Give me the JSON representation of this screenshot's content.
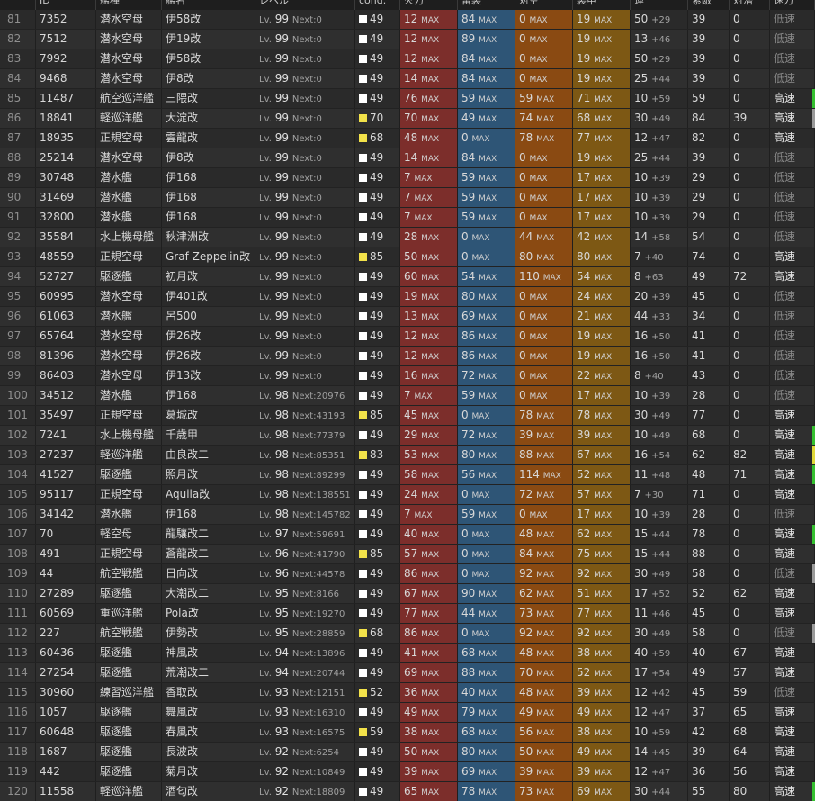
{
  "headers": [
    "ID",
    "艦種",
    "艦名",
    "レベル",
    "cond.",
    "火力",
    "雷装",
    "対空",
    "装甲",
    "運",
    "索敵",
    "対潜",
    "速力"
  ],
  "lv_label": "Lv.",
  "next_label": "Next:",
  "max_label": "MAX",
  "colors": {
    "cond_white": "#ffffff",
    "cond_yellow": "#f2e24a",
    "edge_green": "#35c030",
    "edge_yellow": "#e0d83a",
    "edge_gray": "#9a9a9a"
  },
  "rows": [
    {
      "n": "81",
      "id": "7352",
      "type": "潜水空母",
      "name": "伊58改",
      "lv": "99",
      "next": "0",
      "cond": "49",
      "cc": "w",
      "fp": "12",
      "tp": "84",
      "aa": "0",
      "ar": "19",
      "luck": "50",
      "lplus": "+29",
      "los": "39",
      "asw": "0",
      "speed": "低速",
      "edge": ""
    },
    {
      "n": "82",
      "id": "7512",
      "type": "潜水空母",
      "name": "伊19改",
      "lv": "99",
      "next": "0",
      "cond": "49",
      "cc": "w",
      "fp": "12",
      "tp": "89",
      "aa": "0",
      "ar": "19",
      "luck": "13",
      "lplus": "+46",
      "los": "39",
      "asw": "0",
      "speed": "低速",
      "edge": ""
    },
    {
      "n": "83",
      "id": "7992",
      "type": "潜水空母",
      "name": "伊58改",
      "lv": "99",
      "next": "0",
      "cond": "49",
      "cc": "w",
      "fp": "12",
      "tp": "84",
      "aa": "0",
      "ar": "19",
      "luck": "50",
      "lplus": "+29",
      "los": "39",
      "asw": "0",
      "speed": "低速",
      "edge": ""
    },
    {
      "n": "84",
      "id": "9468",
      "type": "潜水空母",
      "name": "伊8改",
      "lv": "99",
      "next": "0",
      "cond": "49",
      "cc": "w",
      "fp": "14",
      "tp": "84",
      "aa": "0",
      "ar": "19",
      "luck": "25",
      "lplus": "+44",
      "los": "39",
      "asw": "0",
      "speed": "低速",
      "edge": ""
    },
    {
      "n": "85",
      "id": "11487",
      "type": "航空巡洋艦",
      "name": "三隈改",
      "lv": "99",
      "next": "0",
      "cond": "49",
      "cc": "w",
      "fp": "76",
      "tp": "59",
      "aa": "59",
      "ar": "71",
      "luck": "10",
      "lplus": "+59",
      "los": "59",
      "asw": "0",
      "speed": "高速",
      "edge": "g"
    },
    {
      "n": "86",
      "id": "18841",
      "type": "軽巡洋艦",
      "name": "大淀改",
      "lv": "99",
      "next": "0",
      "cond": "70",
      "cc": "y",
      "fp": "70",
      "tp": "49",
      "aa": "74",
      "ar": "68",
      "luck": "30",
      "lplus": "+49",
      "los": "84",
      "asw": "39",
      "speed": "高速",
      "edge": "gr"
    },
    {
      "n": "87",
      "id": "18935",
      "type": "正規空母",
      "name": "雲龍改",
      "lv": "99",
      "next": "0",
      "cond": "68",
      "cc": "y",
      "fp": "48",
      "tp": "0",
      "aa": "78",
      "ar": "77",
      "luck": "12",
      "lplus": "+47",
      "los": "82",
      "asw": "0",
      "speed": "高速",
      "edge": ""
    },
    {
      "n": "88",
      "id": "25214",
      "type": "潜水空母",
      "name": "伊8改",
      "lv": "99",
      "next": "0",
      "cond": "49",
      "cc": "w",
      "fp": "14",
      "tp": "84",
      "aa": "0",
      "ar": "19",
      "luck": "25",
      "lplus": "+44",
      "los": "39",
      "asw": "0",
      "speed": "低速",
      "edge": ""
    },
    {
      "n": "89",
      "id": "30748",
      "type": "潜水艦",
      "name": "伊168",
      "lv": "99",
      "next": "0",
      "cond": "49",
      "cc": "w",
      "fp": "7",
      "tp": "59",
      "aa": "0",
      "ar": "17",
      "luck": "10",
      "lplus": "+39",
      "los": "29",
      "asw": "0",
      "speed": "低速",
      "edge": ""
    },
    {
      "n": "90",
      "id": "31469",
      "type": "潜水艦",
      "name": "伊168",
      "lv": "99",
      "next": "0",
      "cond": "49",
      "cc": "w",
      "fp": "7",
      "tp": "59",
      "aa": "0",
      "ar": "17",
      "luck": "10",
      "lplus": "+39",
      "los": "29",
      "asw": "0",
      "speed": "低速",
      "edge": ""
    },
    {
      "n": "91",
      "id": "32800",
      "type": "潜水艦",
      "name": "伊168",
      "lv": "99",
      "next": "0",
      "cond": "49",
      "cc": "w",
      "fp": "7",
      "tp": "59",
      "aa": "0",
      "ar": "17",
      "luck": "10",
      "lplus": "+39",
      "los": "29",
      "asw": "0",
      "speed": "低速",
      "edge": ""
    },
    {
      "n": "92",
      "id": "35584",
      "type": "水上機母艦",
      "name": "秋津洲改",
      "lv": "99",
      "next": "0",
      "cond": "49",
      "cc": "w",
      "fp": "28",
      "tp": "0",
      "aa": "44",
      "ar": "42",
      "luck": "14",
      "lplus": "+58",
      "los": "54",
      "asw": "0",
      "speed": "低速",
      "edge": ""
    },
    {
      "n": "93",
      "id": "48559",
      "type": "正規空母",
      "name": "Graf Zeppelin改",
      "lv": "99",
      "next": "0",
      "cond": "85",
      "cc": "y",
      "fp": "50",
      "tp": "0",
      "aa": "80",
      "ar": "80",
      "luck": "7",
      "lplus": "+40",
      "los": "74",
      "asw": "0",
      "speed": "高速",
      "edge": ""
    },
    {
      "n": "94",
      "id": "52727",
      "type": "駆逐艦",
      "name": "初月改",
      "lv": "99",
      "next": "0",
      "cond": "49",
      "cc": "w",
      "fp": "60",
      "tp": "54",
      "aa": "110",
      "ar": "54",
      "luck": "8",
      "lplus": "+63",
      "los": "49",
      "asw": "72",
      "speed": "高速",
      "edge": ""
    },
    {
      "n": "95",
      "id": "60995",
      "type": "潜水空母",
      "name": "伊401改",
      "lv": "99",
      "next": "0",
      "cond": "49",
      "cc": "w",
      "fp": "19",
      "tp": "80",
      "aa": "0",
      "ar": "24",
      "luck": "20",
      "lplus": "+39",
      "los": "45",
      "asw": "0",
      "speed": "低速",
      "edge": ""
    },
    {
      "n": "96",
      "id": "61063",
      "type": "潜水艦",
      "name": "呂500",
      "lv": "99",
      "next": "0",
      "cond": "49",
      "cc": "w",
      "fp": "13",
      "tp": "69",
      "aa": "0",
      "ar": "21",
      "luck": "44",
      "lplus": "+33",
      "los": "34",
      "asw": "0",
      "speed": "低速",
      "edge": ""
    },
    {
      "n": "97",
      "id": "65764",
      "type": "潜水空母",
      "name": "伊26改",
      "lv": "99",
      "next": "0",
      "cond": "49",
      "cc": "w",
      "fp": "12",
      "tp": "86",
      "aa": "0",
      "ar": "19",
      "luck": "16",
      "lplus": "+50",
      "los": "41",
      "asw": "0",
      "speed": "低速",
      "edge": ""
    },
    {
      "n": "98",
      "id": "81396",
      "type": "潜水空母",
      "name": "伊26改",
      "lv": "99",
      "next": "0",
      "cond": "49",
      "cc": "w",
      "fp": "12",
      "tp": "86",
      "aa": "0",
      "ar": "19",
      "luck": "16",
      "lplus": "+50",
      "los": "41",
      "asw": "0",
      "speed": "低速",
      "edge": ""
    },
    {
      "n": "99",
      "id": "86403",
      "type": "潜水空母",
      "name": "伊13改",
      "lv": "99",
      "next": "0",
      "cond": "49",
      "cc": "w",
      "fp": "16",
      "tp": "72",
      "aa": "0",
      "ar": "22",
      "luck": "8",
      "lplus": "+40",
      "los": "43",
      "asw": "0",
      "speed": "低速",
      "edge": ""
    },
    {
      "n": "100",
      "id": "34512",
      "type": "潜水艦",
      "name": "伊168",
      "lv": "98",
      "next": "20976",
      "cond": "49",
      "cc": "w",
      "fp": "7",
      "tp": "59",
      "aa": "0",
      "ar": "17",
      "luck": "10",
      "lplus": "+39",
      "los": "28",
      "asw": "0",
      "speed": "低速",
      "edge": ""
    },
    {
      "n": "101",
      "id": "35497",
      "type": "正規空母",
      "name": "葛城改",
      "lv": "98",
      "next": "43193",
      "cond": "85",
      "cc": "y",
      "fp": "45",
      "tp": "0",
      "aa": "78",
      "ar": "78",
      "luck": "30",
      "lplus": "+49",
      "los": "77",
      "asw": "0",
      "speed": "高速",
      "edge": ""
    },
    {
      "n": "102",
      "id": "7241",
      "type": "水上機母艦",
      "name": "千歳甲",
      "lv": "98",
      "next": "77379",
      "cond": "49",
      "cc": "w",
      "fp": "29",
      "tp": "72",
      "aa": "39",
      "ar": "39",
      "luck": "10",
      "lplus": "+49",
      "los": "68",
      "asw": "0",
      "speed": "高速",
      "edge": "g"
    },
    {
      "n": "103",
      "id": "27237",
      "type": "軽巡洋艦",
      "name": "由良改二",
      "lv": "98",
      "next": "85351",
      "cond": "83",
      "cc": "y",
      "fp": "53",
      "tp": "80",
      "aa": "88",
      "ar": "67",
      "luck": "16",
      "lplus": "+54",
      "los": "62",
      "asw": "82",
      "speed": "高速",
      "edge": "y"
    },
    {
      "n": "104",
      "id": "41527",
      "type": "駆逐艦",
      "name": "照月改",
      "lv": "98",
      "next": "89299",
      "cond": "49",
      "cc": "w",
      "fp": "58",
      "tp": "56",
      "aa": "114",
      "ar": "52",
      "luck": "11",
      "lplus": "+48",
      "los": "48",
      "asw": "71",
      "speed": "高速",
      "edge": "g"
    },
    {
      "n": "105",
      "id": "95117",
      "type": "正規空母",
      "name": "Aquila改",
      "lv": "98",
      "next": "138551",
      "cond": "49",
      "cc": "w",
      "fp": "24",
      "tp": "0",
      "aa": "72",
      "ar": "57",
      "luck": "7",
      "lplus": "+30",
      "los": "71",
      "asw": "0",
      "speed": "高速",
      "edge": ""
    },
    {
      "n": "106",
      "id": "34142",
      "type": "潜水艦",
      "name": "伊168",
      "lv": "98",
      "next": "145782",
      "cond": "49",
      "cc": "w",
      "fp": "7",
      "tp": "59",
      "aa": "0",
      "ar": "17",
      "luck": "10",
      "lplus": "+39",
      "los": "28",
      "asw": "0",
      "speed": "低速",
      "edge": ""
    },
    {
      "n": "107",
      "id": "70",
      "type": "軽空母",
      "name": "龍驤改二",
      "lv": "97",
      "next": "59691",
      "cond": "49",
      "cc": "w",
      "fp": "40",
      "tp": "0",
      "aa": "48",
      "ar": "62",
      "luck": "15",
      "lplus": "+44",
      "los": "78",
      "asw": "0",
      "speed": "高速",
      "edge": "g"
    },
    {
      "n": "108",
      "id": "491",
      "type": "正規空母",
      "name": "蒼龍改二",
      "lv": "96",
      "next": "41790",
      "cond": "85",
      "cc": "y",
      "fp": "57",
      "tp": "0",
      "aa": "84",
      "ar": "75",
      "luck": "15",
      "lplus": "+44",
      "los": "88",
      "asw": "0",
      "speed": "高速",
      "edge": ""
    },
    {
      "n": "109",
      "id": "44",
      "type": "航空戦艦",
      "name": "日向改",
      "lv": "96",
      "next": "44578",
      "cond": "49",
      "cc": "w",
      "fp": "86",
      "tp": "0",
      "aa": "92",
      "ar": "92",
      "luck": "30",
      "lplus": "+49",
      "los": "58",
      "asw": "0",
      "speed": "低速",
      "edge": "gr"
    },
    {
      "n": "110",
      "id": "27289",
      "type": "駆逐艦",
      "name": "大潮改二",
      "lv": "95",
      "next": "8166",
      "cond": "49",
      "cc": "w",
      "fp": "67",
      "tp": "90",
      "aa": "62",
      "ar": "51",
      "luck": "17",
      "lplus": "+52",
      "los": "52",
      "asw": "62",
      "speed": "高速",
      "edge": ""
    },
    {
      "n": "111",
      "id": "60569",
      "type": "重巡洋艦",
      "name": "Pola改",
      "lv": "95",
      "next": "19270",
      "cond": "49",
      "cc": "w",
      "fp": "77",
      "tp": "44",
      "aa": "73",
      "ar": "77",
      "luck": "11",
      "lplus": "+46",
      "los": "45",
      "asw": "0",
      "speed": "高速",
      "edge": ""
    },
    {
      "n": "112",
      "id": "227",
      "type": "航空戦艦",
      "name": "伊勢改",
      "lv": "95",
      "next": "28859",
      "cond": "68",
      "cc": "y",
      "fp": "86",
      "tp": "0",
      "aa": "92",
      "ar": "92",
      "luck": "30",
      "lplus": "+49",
      "los": "58",
      "asw": "0",
      "speed": "低速",
      "edge": "gr"
    },
    {
      "n": "113",
      "id": "60436",
      "type": "駆逐艦",
      "name": "神風改",
      "lv": "94",
      "next": "13896",
      "cond": "49",
      "cc": "w",
      "fp": "41",
      "tp": "68",
      "aa": "48",
      "ar": "38",
      "luck": "40",
      "lplus": "+59",
      "los": "40",
      "asw": "67",
      "speed": "高速",
      "edge": ""
    },
    {
      "n": "114",
      "id": "27254",
      "type": "駆逐艦",
      "name": "荒潮改二",
      "lv": "94",
      "next": "20744",
      "cond": "49",
      "cc": "w",
      "fp": "69",
      "tp": "88",
      "aa": "70",
      "ar": "52",
      "luck": "17",
      "lplus": "+54",
      "los": "49",
      "asw": "57",
      "speed": "高速",
      "edge": ""
    },
    {
      "n": "115",
      "id": "30960",
      "type": "練習巡洋艦",
      "name": "香取改",
      "lv": "93",
      "next": "12151",
      "cond": "52",
      "cc": "y",
      "fp": "36",
      "tp": "40",
      "aa": "48",
      "ar": "39",
      "luck": "12",
      "lplus": "+42",
      "los": "45",
      "asw": "59",
      "speed": "低速",
      "edge": ""
    },
    {
      "n": "116",
      "id": "1057",
      "type": "駆逐艦",
      "name": "舞風改",
      "lv": "93",
      "next": "16310",
      "cond": "49",
      "cc": "w",
      "fp": "49",
      "tp": "79",
      "aa": "49",
      "ar": "49",
      "luck": "12",
      "lplus": "+47",
      "los": "37",
      "asw": "65",
      "speed": "高速",
      "edge": ""
    },
    {
      "n": "117",
      "id": "60648",
      "type": "駆逐艦",
      "name": "春風改",
      "lv": "93",
      "next": "16575",
      "cond": "59",
      "cc": "y",
      "fp": "38",
      "tp": "68",
      "aa": "56",
      "ar": "38",
      "luck": "10",
      "lplus": "+59",
      "los": "42",
      "asw": "68",
      "speed": "高速",
      "edge": ""
    },
    {
      "n": "118",
      "id": "1687",
      "type": "駆逐艦",
      "name": "長波改",
      "lv": "92",
      "next": "6254",
      "cond": "49",
      "cc": "w",
      "fp": "50",
      "tp": "80",
      "aa": "50",
      "ar": "49",
      "luck": "14",
      "lplus": "+45",
      "los": "39",
      "asw": "64",
      "speed": "高速",
      "edge": ""
    },
    {
      "n": "119",
      "id": "442",
      "type": "駆逐艦",
      "name": "菊月改",
      "lv": "92",
      "next": "10849",
      "cond": "49",
      "cc": "w",
      "fp": "39",
      "tp": "69",
      "aa": "39",
      "ar": "39",
      "luck": "12",
      "lplus": "+47",
      "los": "36",
      "asw": "56",
      "speed": "高速",
      "edge": ""
    },
    {
      "n": "120",
      "id": "11558",
      "type": "軽巡洋艦",
      "name": "酒匂改",
      "lv": "92",
      "next": "18809",
      "cond": "49",
      "cc": "w",
      "fp": "65",
      "tp": "78",
      "aa": "73",
      "ar": "69",
      "luck": "30",
      "lplus": "+44",
      "los": "55",
      "asw": "80",
      "speed": "高速",
      "edge": "g"
    }
  ]
}
